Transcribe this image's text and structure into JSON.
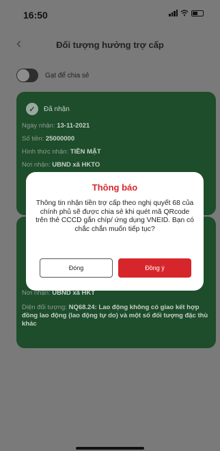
{
  "status_bar": {
    "time": "16:50"
  },
  "nav": {
    "back_icon": "chevron-left-icon",
    "title": "Đối tượng hưởng trợ cấp"
  },
  "share": {
    "label": "Gạt để chia sẻ",
    "enabled": false
  },
  "card1": {
    "status": "Đã nhận",
    "fields": [
      {
        "label": "Ngày nhận: ",
        "value": "13-11-2021"
      },
      {
        "label": "Số tiền: ",
        "value": "25000000"
      },
      {
        "label": "Hình thức nhận: ",
        "value": "TIỀN MẶT"
      },
      {
        "label": "Nơi nhận: ",
        "value": "UBND xã HKTO"
      }
    ]
  },
  "card2": {
    "fields": [
      {
        "label": "Nơi nhận: ",
        "value": "UBND xã HKT"
      },
      {
        "label": "Diện đối tượng: ",
        "value": "NQ68.24: Lao động không có giao kết hợp đồng lao động (lao động tự do) và một số đối tượng đặc thù khác"
      }
    ]
  },
  "modal": {
    "title": "Thông báo",
    "message": "Thông tin nhận tiền trợ cấp theo nghị quyết 68 của chính phủ sẽ được chia sẻ khi quét mã QRcode trên thẻ CCCD gắn chíp/ ứng dụng VNEID. Bạn có chắc chắn muốn tiếp tục?",
    "cancel_label": "Đóng",
    "confirm_label": "Đồng ý"
  },
  "colors": {
    "accent": "#d7262b",
    "card_bg": "#1d4d2a",
    "overlay": "#7a7a7a"
  }
}
